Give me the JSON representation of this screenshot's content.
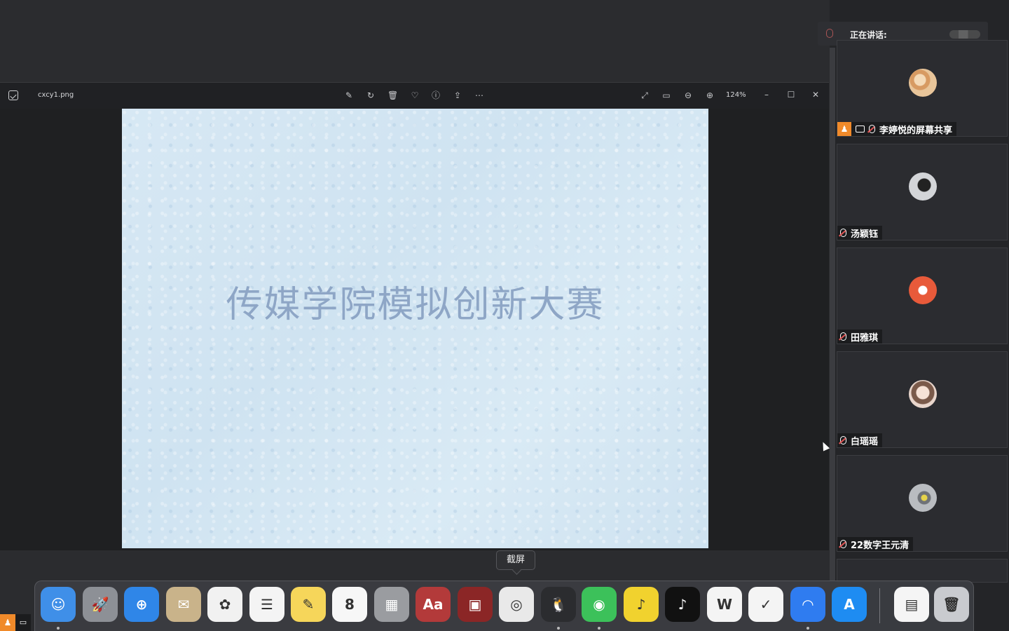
{
  "viewer": {
    "file_name": "cxcy1.png",
    "zoom": "124%",
    "slide_title": "传媒学院模拟创新大赛"
  },
  "speaking": {
    "label": "正在讲话:"
  },
  "participants": [
    {
      "name": "李婷悦的屏幕共享",
      "avatar_color": "#e8c59a"
    },
    {
      "name": "汤颖钰",
      "avatar_color": "#cfd1d4"
    },
    {
      "name": "田雅琪",
      "avatar_color": "#e85a3a"
    },
    {
      "name": "白瑶瑶",
      "avatar_color": "#e9d6cc"
    },
    {
      "name": "22数字王元清",
      "avatar_color": "#b9bcc0"
    }
  ],
  "tooltip": {
    "label": "截屏"
  },
  "dock": {
    "icons": [
      {
        "name": "finder",
        "color": "#3f8fe8",
        "glyph": "☺"
      },
      {
        "name": "launchpad",
        "color": "#8d9096",
        "glyph": "🚀"
      },
      {
        "name": "safari",
        "color": "#2f86e8",
        "glyph": "⊕"
      },
      {
        "name": "mail",
        "color": "#c9b38a",
        "glyph": "✉"
      },
      {
        "name": "photos",
        "color": "#f1f1f1",
        "glyph": "✿"
      },
      {
        "name": "reminders",
        "color": "#f4f4f4",
        "glyph": "☰"
      },
      {
        "name": "notes",
        "color": "#f6d65a",
        "glyph": "✎"
      },
      {
        "name": "calendar",
        "color": "#f7f7f7",
        "glyph": "8"
      },
      {
        "name": "calculator",
        "color": "#9a9ca0",
        "glyph": "▦"
      },
      {
        "name": "dictionary",
        "color": "#b33a3a",
        "glyph": "Aa"
      },
      {
        "name": "photo-booth",
        "color": "#8b2626",
        "glyph": "▣"
      },
      {
        "name": "screenshot",
        "color": "#e9e9e9",
        "glyph": "◎"
      },
      {
        "name": "qq",
        "color": "#2b2c2f",
        "glyph": "🐧"
      },
      {
        "name": "wechat",
        "color": "#3cc15a",
        "glyph": "◉"
      },
      {
        "name": "qq-music",
        "color": "#f1d22e",
        "glyph": "♪"
      },
      {
        "name": "tiktok",
        "color": "#111111",
        "glyph": "♪"
      },
      {
        "name": "wps",
        "color": "#f4f4f4",
        "glyph": "W"
      },
      {
        "name": "youdao",
        "color": "#f4f4f4",
        "glyph": "✓"
      },
      {
        "name": "tencent-meeting",
        "color": "#2f7cf0",
        "glyph": "◠"
      },
      {
        "name": "app-store",
        "color": "#1e8cf2",
        "glyph": "A"
      },
      {
        "name": "preview",
        "color": "#f5f5f5",
        "glyph": "▤"
      },
      {
        "name": "trash",
        "color": "#c9cbcf",
        "glyph": "🗑"
      }
    ]
  }
}
